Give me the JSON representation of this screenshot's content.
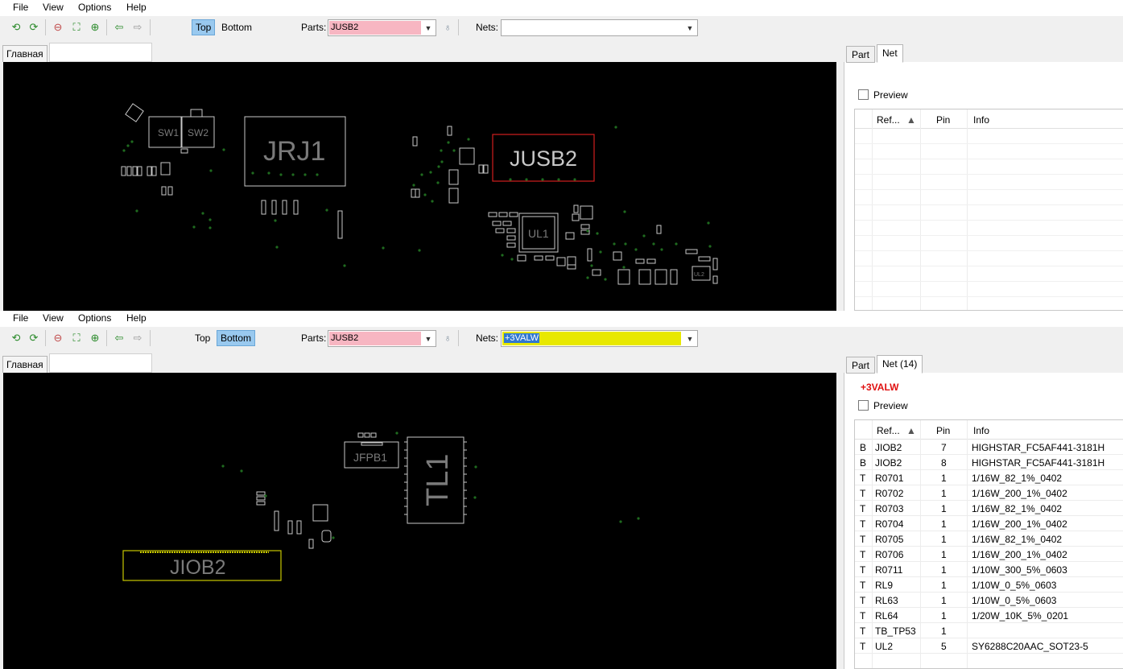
{
  "menu": [
    "File",
    "View",
    "Options",
    "Help"
  ],
  "pane_top": {
    "side_top": "Top",
    "side_bottom": "Bottom",
    "active_side": "Top",
    "parts_label": "Parts:",
    "parts_value": "JUSB2",
    "nets_label": "Nets:",
    "nets_value": "",
    "doc_tab": "Главная",
    "tabs": [
      "Part",
      "Net"
    ],
    "active_tab": "Net",
    "preview_label": "Preview",
    "columns": [
      "Ref...",
      "Pin",
      "Info"
    ],
    "board_labels": {
      "jrj1": "JRJ1",
      "jusb2": "JUSB2",
      "sw1": "SW1",
      "sw2": "SW2",
      "ul1": "UL1",
      "ul2": "UL2"
    }
  },
  "pane_bottom": {
    "side_top": "Top",
    "side_bottom": "Bottom",
    "active_side": "Bottom",
    "parts_label": "Parts:",
    "parts_value": "JUSB2",
    "nets_label": "Nets:",
    "nets_value": "+3VALW",
    "doc_tab": "Главная",
    "tabs": [
      "Part",
      "Net (14)"
    ],
    "active_tab": "Net (14)",
    "net_name": "+3VALW",
    "preview_label": "Preview",
    "columns": [
      "Ref...",
      "Pin",
      "Info"
    ],
    "board_labels": {
      "jfpb1": "JFPB1",
      "tl1": "TL1",
      "jiob2": "JIOB2"
    },
    "rows": [
      {
        "side": "B",
        "ref": "JIOB2",
        "pin": "7",
        "info": "HIGHSTAR_FC5AF441-3181H"
      },
      {
        "side": "B",
        "ref": "JIOB2",
        "pin": "8",
        "info": "HIGHSTAR_FC5AF441-3181H"
      },
      {
        "side": "T",
        "ref": "R0701",
        "pin": "1",
        "info": "1/16W_82_1%_0402"
      },
      {
        "side": "T",
        "ref": "R0702",
        "pin": "1",
        "info": "1/16W_200_1%_0402"
      },
      {
        "side": "T",
        "ref": "R0703",
        "pin": "1",
        "info": "1/16W_82_1%_0402"
      },
      {
        "side": "T",
        "ref": "R0704",
        "pin": "1",
        "info": "1/16W_200_1%_0402"
      },
      {
        "side": "T",
        "ref": "R0705",
        "pin": "1",
        "info": "1/16W_82_1%_0402"
      },
      {
        "side": "T",
        "ref": "R0706",
        "pin": "1",
        "info": "1/16W_200_1%_0402"
      },
      {
        "side": "T",
        "ref": "R0711",
        "pin": "1",
        "info": "1/10W_300_5%_0603"
      },
      {
        "side": "T",
        "ref": "RL9",
        "pin": "1",
        "info": "1/10W_0_5%_0603"
      },
      {
        "side": "T",
        "ref": "RL63",
        "pin": "1",
        "info": "1/10W_0_5%_0603"
      },
      {
        "side": "T",
        "ref": "RL64",
        "pin": "1",
        "info": "1/20W_10K_5%_0201"
      },
      {
        "side": "T",
        "ref": "TB_TP53",
        "pin": "1",
        "info": ""
      },
      {
        "side": "T",
        "ref": "UL2",
        "pin": "5",
        "info": "SY6288C20AAC_SOT23-5"
      }
    ]
  },
  "colors": {
    "board_bg": "#000000",
    "outline": "#c8c8c8",
    "selected_part": "#d21e1e",
    "net_highlight": "#e8e800",
    "via": "#1f6b1f",
    "parts_combo_bg": "#f7b6c2",
    "active_side_bg": "#99c9ef",
    "net_name_color": "#e01010"
  },
  "icons": [
    "refresh-left-icon",
    "refresh-right-icon",
    "zoom-out-icon",
    "fit-icon",
    "zoom-in-icon",
    "back-arrow-icon",
    "forward-arrow-icon",
    "bulb-icon",
    "dropdown-arrow-icon",
    "sort-up-icon"
  ]
}
